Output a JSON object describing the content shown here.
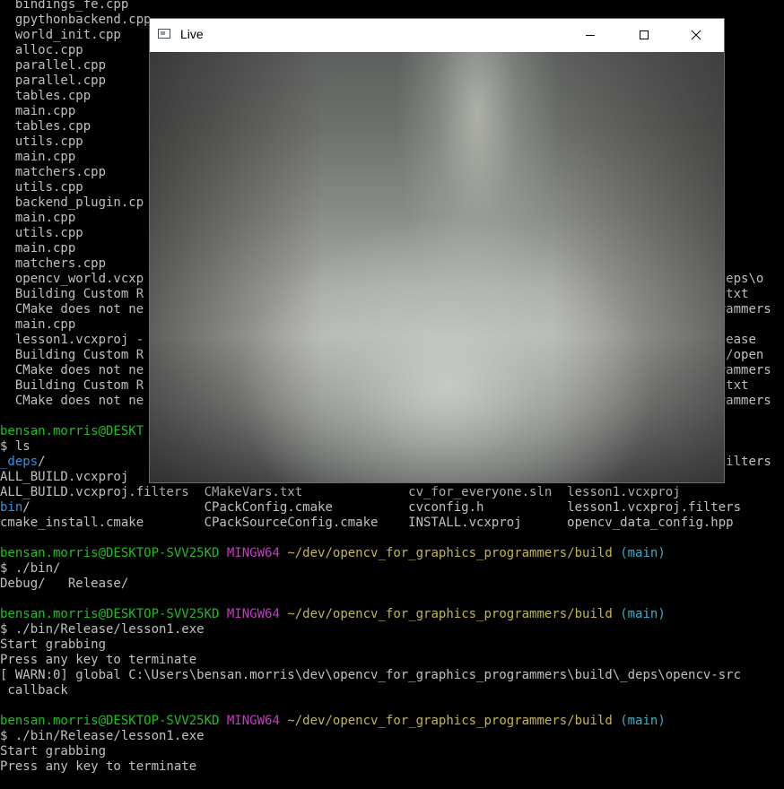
{
  "terminal": {
    "lines": [
      {
        "text": "  bindings_fe.cpp"
      },
      {
        "text": "  gpythonbackend.cpp"
      },
      {
        "text": "  world_init.cpp"
      },
      {
        "text": "  alloc.cpp"
      },
      {
        "text": "  parallel.cpp"
      },
      {
        "text": "  parallel.cpp"
      },
      {
        "text": "  tables.cpp"
      },
      {
        "text": "  main.cpp"
      },
      {
        "text": "  tables.cpp"
      },
      {
        "text": "  utils.cpp"
      },
      {
        "text": "  main.cpp"
      },
      {
        "text": "  matchers.cpp"
      },
      {
        "text": "  utils.cpp"
      },
      {
        "text": "  backend_plugin.cp"
      },
      {
        "text": "  main.cpp"
      },
      {
        "text": "  utils.cpp"
      },
      {
        "text": "  main.cpp"
      },
      {
        "text": "  matchers.cpp"
      },
      {
        "text": "  opencv_world.vcxp                                                                          \\_deps\\o"
      },
      {
        "text": "  Building Custom R                                                                          ts.txt"
      },
      {
        "text": "  CMake does not ne                                                                          ogrammers"
      },
      {
        "text": "  main.cpp"
      },
      {
        "text": "  lesson1.vcxproj -                                                                          Release"
      },
      {
        "text": "  Building Custom R                                                                          eps/open"
      },
      {
        "text": "  CMake does not ne                                                                          ogrammers"
      },
      {
        "text": "  Building Custom R                                                                          ts.txt"
      },
      {
        "text": "  CMake does not ne                                                                          ogrammers"
      },
      {
        "text": ""
      },
      {
        "segments": [
          {
            "text": "bensan.morris@DESKT",
            "color": "g"
          }
        ]
      },
      {
        "text": "$ ls"
      },
      {
        "segments": [
          {
            "text": "_deps",
            "color": "b"
          },
          {
            "text": "/                                                                                         filters"
          }
        ]
      },
      {
        "text": "ALL_BUILD.vcxproj"
      },
      {
        "text": "ALL_BUILD.vcxproj.filters  CMakeVars.txt              cv_for_everyone.sln  lesson1.vcxproj"
      },
      {
        "segments": [
          {
            "text": "bin",
            "color": "b"
          },
          {
            "text": "/                       CPackConfig.cmake          cvconfig.h           lesson1.vcxproj.filters"
          }
        ]
      },
      {
        "text": "cmake_install.cmake        CPackSourceConfig.cmake    INSTALL.vcxproj      opencv_data_config.hpp"
      },
      {
        "text": ""
      },
      {
        "segments": [
          {
            "text": "bensan.morris@DESKTOP-SVV25KD",
            "color": "g"
          },
          {
            "text": " "
          },
          {
            "text": "MINGW64",
            "color": "m"
          },
          {
            "text": " "
          },
          {
            "text": "~/dev/opencv_for_graphics_programmers/build",
            "color": "y"
          },
          {
            "text": " "
          },
          {
            "text": "(main)",
            "color": "c"
          }
        ]
      },
      {
        "text": "$ ./bin/"
      },
      {
        "text": "Debug/   Release/"
      },
      {
        "text": ""
      },
      {
        "segments": [
          {
            "text": "bensan.morris@DESKTOP-SVV25KD",
            "color": "g"
          },
          {
            "text": " "
          },
          {
            "text": "MINGW64",
            "color": "m"
          },
          {
            "text": " "
          },
          {
            "text": "~/dev/opencv_for_graphics_programmers/build",
            "color": "y"
          },
          {
            "text": " "
          },
          {
            "text": "(main)",
            "color": "c"
          }
        ]
      },
      {
        "text": "$ ./bin/Release/lesson1.exe"
      },
      {
        "text": "Start grabbing"
      },
      {
        "text": "Press any key to terminate"
      },
      {
        "text": "[ WARN:0] global C:\\Users\\bensan.morris\\dev\\opencv_for_graphics_programmers\\build\\_deps\\opencv-src"
      },
      {
        "text": " callback"
      },
      {
        "text": ""
      },
      {
        "segments": [
          {
            "text": "bensan.morris@DESKTOP-SVV25KD",
            "color": "g"
          },
          {
            "text": " "
          },
          {
            "text": "MINGW64",
            "color": "m"
          },
          {
            "text": " "
          },
          {
            "text": "~/dev/opencv_for_graphics_programmers/build",
            "color": "y"
          },
          {
            "text": " "
          },
          {
            "text": "(main)",
            "color": "c"
          }
        ]
      },
      {
        "text": "$ ./bin/Release/lesson1.exe"
      },
      {
        "text": "Start grabbing"
      },
      {
        "text": "Press any key to terminate"
      }
    ]
  },
  "window": {
    "title": "Live",
    "icon": "app-window-icon",
    "buttons": [
      "minimize-icon",
      "maximize-icon",
      "close-icon"
    ]
  },
  "colors": {
    "terminal_bg": "#000000",
    "text": "#c0c0c0",
    "user_host": "#1fbf1f",
    "mingw": "#c43cc4",
    "path": "#c5b64a",
    "branch": "#3ab0c8",
    "directory": "#3b8fd8"
  }
}
